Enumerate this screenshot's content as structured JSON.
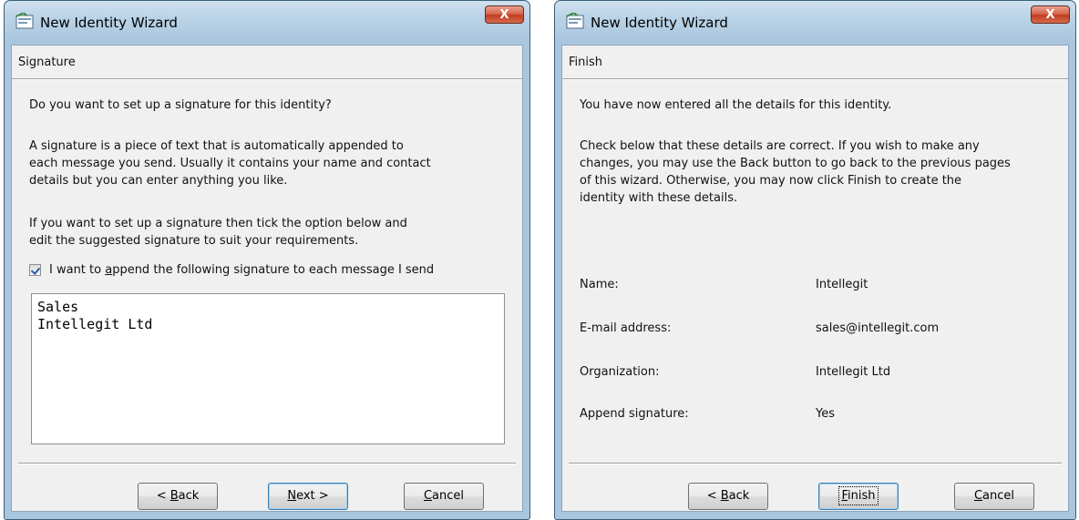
{
  "left_window": {
    "title": "New Identity Wizard",
    "close_glyph": "X",
    "page_title": "Signature",
    "question": "Do you want to set up a signature for this identity?",
    "description_lines": [
      "A signature is a piece of text that is automatically appended to",
      "each message you send.  Usually it contains your name and contact",
      "details but you can enter anything you like."
    ],
    "instruction_lines": [
      "If you want to set up a signature then tick the option below and",
      "edit the suggested signature to suit your requirements."
    ],
    "checkbox": {
      "checked": true,
      "label_before": "I want to ",
      "label_access": "a",
      "label_after": "ppend the following signature to each message I send"
    },
    "signature_text": "Sales\nIntellegit Ltd",
    "buttons": {
      "back": {
        "prefix": "< ",
        "access": "B",
        "rest": "ack"
      },
      "next": {
        "access": "N",
        "rest": "ext >"
      },
      "cancel": {
        "access": "C",
        "rest": "ancel"
      }
    }
  },
  "right_window": {
    "title": "New Identity Wizard",
    "close_glyph": "X",
    "page_title": "Finish",
    "intro": "You have now entered all the details for this identity.",
    "instruction_lines": [
      "Check below that these details are correct.  If you wish to make any",
      "changes, you may use the Back button to go back to the previous pages",
      "of this wizard.  Otherwise, you may now click Finish to create the",
      "identity with these details."
    ],
    "details": [
      {
        "label": "Name:",
        "value": "Intellegit"
      },
      {
        "label": "E-mail address:",
        "value": "sales@intellegit.com"
      },
      {
        "label": "Organization:",
        "value": "Intellegit Ltd"
      },
      {
        "label": "Append signature:",
        "value": "Yes"
      }
    ],
    "buttons": {
      "back": {
        "prefix": "< ",
        "access": "B",
        "rest": "ack"
      },
      "finish": {
        "access": "F",
        "rest": "inish"
      },
      "cancel": {
        "access": "C",
        "rest": "ancel"
      }
    }
  },
  "icons": {
    "app": "wizard-icon",
    "close": "close-icon"
  },
  "colors": {
    "frame": "#b9d2e6",
    "client": "#f0f0f0",
    "close_button": "#c13d22",
    "checkmark": "#2a5ca8"
  }
}
